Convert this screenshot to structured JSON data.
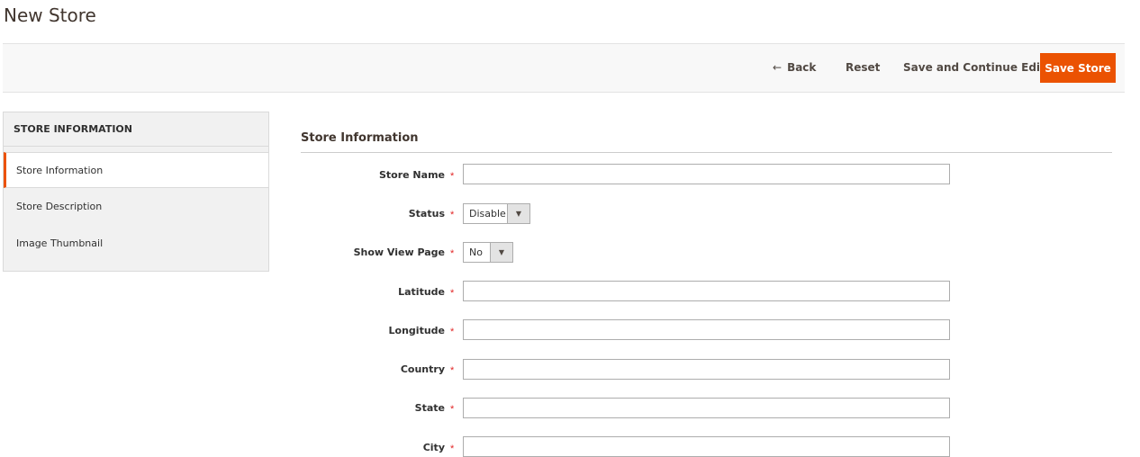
{
  "page": {
    "title": "New Store"
  },
  "toolbar": {
    "back_label": "Back",
    "back_icon": "←",
    "reset_label": "Reset",
    "save_continue_label": "Save and Continue Edit",
    "save_label": "Save Store",
    "accent_color": "#eb5202"
  },
  "sidebar": {
    "title": "STORE INFORMATION",
    "items": [
      {
        "label": "Store Information",
        "active": true
      },
      {
        "label": "Store Description",
        "active": false
      },
      {
        "label": "Image Thumbnail",
        "active": false
      }
    ]
  },
  "form": {
    "section_title": "Store Information",
    "required_marker": "*",
    "fields": {
      "store_name": {
        "label": "Store Name",
        "value": ""
      },
      "status": {
        "label": "Status",
        "value": "Disable",
        "icon": "chevron-down-icon"
      },
      "show_view_page": {
        "label": "Show View Page",
        "value": "No",
        "icon": "chevron-down-icon"
      },
      "latitude": {
        "label": "Latitude",
        "value": ""
      },
      "longitude": {
        "label": "Longitude",
        "value": ""
      },
      "country": {
        "label": "Country",
        "value": ""
      },
      "state": {
        "label": "State",
        "value": ""
      },
      "city": {
        "label": "City",
        "value": ""
      }
    }
  }
}
